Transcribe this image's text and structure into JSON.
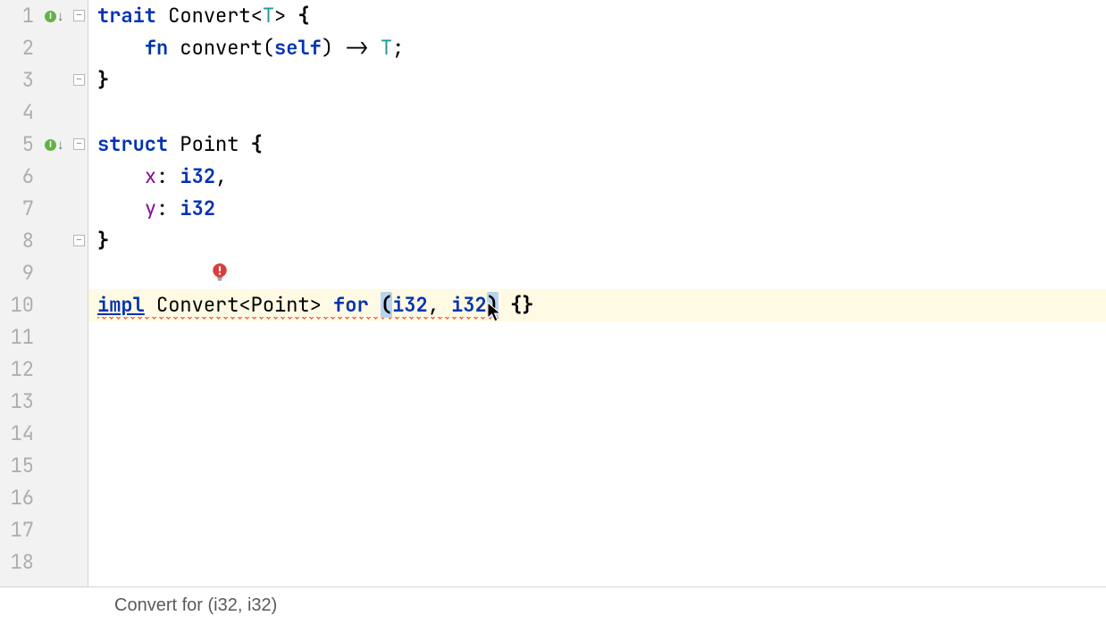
{
  "line_count": 18,
  "gutter": {
    "impl_icons": [
      {
        "line": 1
      },
      {
        "line": 5
      }
    ],
    "fold_icons": [
      {
        "line": 1,
        "glyph": "−"
      },
      {
        "line": 3,
        "glyph": "−"
      },
      {
        "line": 5,
        "glyph": "−"
      },
      {
        "line": 8,
        "glyph": "−"
      }
    ]
  },
  "code": {
    "l1": {
      "kw": "trait",
      "name": "Convert",
      "lt": "<",
      "gen": "T",
      "gt": ">",
      "brace": " {"
    },
    "l2": {
      "indent": "    ",
      "kw": "fn",
      "name": " convert",
      "lp": "(",
      "self": "self",
      "rp": ")",
      "arrow": " -> ",
      "ret": "T",
      "semi": ";"
    },
    "l3": {
      "brace": "}"
    },
    "l5": {
      "kw": "struct",
      "name": "Point",
      "brace": " {"
    },
    "l6": {
      "indent": "    ",
      "field": "x",
      "colon": ": ",
      "ty": "i32",
      "comma": ","
    },
    "l7": {
      "indent": "    ",
      "field": "y",
      "colon": ": ",
      "ty": "i32"
    },
    "l8": {
      "brace": "}"
    },
    "l10": {
      "kw_impl": "impl",
      "sp1": " ",
      "trait": "Convert",
      "lt": "<",
      "targ": "Point",
      "gt": ">",
      "sp2": " ",
      "kw_for": "for",
      "sp3": " ",
      "lp": "(",
      "a": "i32",
      "comma": ", ",
      "b": "i32",
      "rp": ")",
      "sp4": " ",
      "body": "{}"
    }
  },
  "intention": {
    "name": "error-intention-bulb"
  },
  "breadcrumbs": {
    "text": "Convert for (i32, i32)"
  },
  "highlighted_line": 10
}
